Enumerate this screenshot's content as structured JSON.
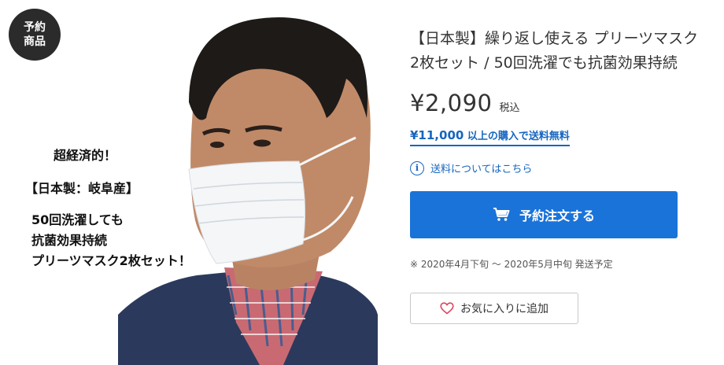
{
  "badge": {
    "line1": "予約",
    "line2": "商品"
  },
  "image_text": {
    "line1": "超経済的！",
    "line2": "【日本製：岐阜産】",
    "line3": "50回洗濯しても",
    "line4": "抗菌効果持続",
    "line5": "プリーツマスク2枚セット！"
  },
  "product": {
    "title": "【日本製】繰り返し使える プリーツマスク 2枚セット / 50回洗濯でも抗菌効果持続",
    "price": "¥2,090",
    "tax_label": "税込",
    "free_shipping_amount": "¥11,000",
    "free_shipping_text": " 以上の購入で送料無料",
    "shipping_info_link": "送料についてはこちら",
    "order_button_label": "予約注文する",
    "delivery_schedule": "※ 2020年4月下旬 〜 2020年5月中旬 発送予定",
    "favorite_button_label": "お気に入りに追加"
  },
  "icons": {
    "info": "info-icon",
    "cart": "cart-icon",
    "heart": "heart-icon"
  },
  "colors": {
    "accent": "#1a73d9",
    "link": "#1565c0",
    "badge_bg": "#2b2b2b",
    "heart": "#e0405b"
  }
}
